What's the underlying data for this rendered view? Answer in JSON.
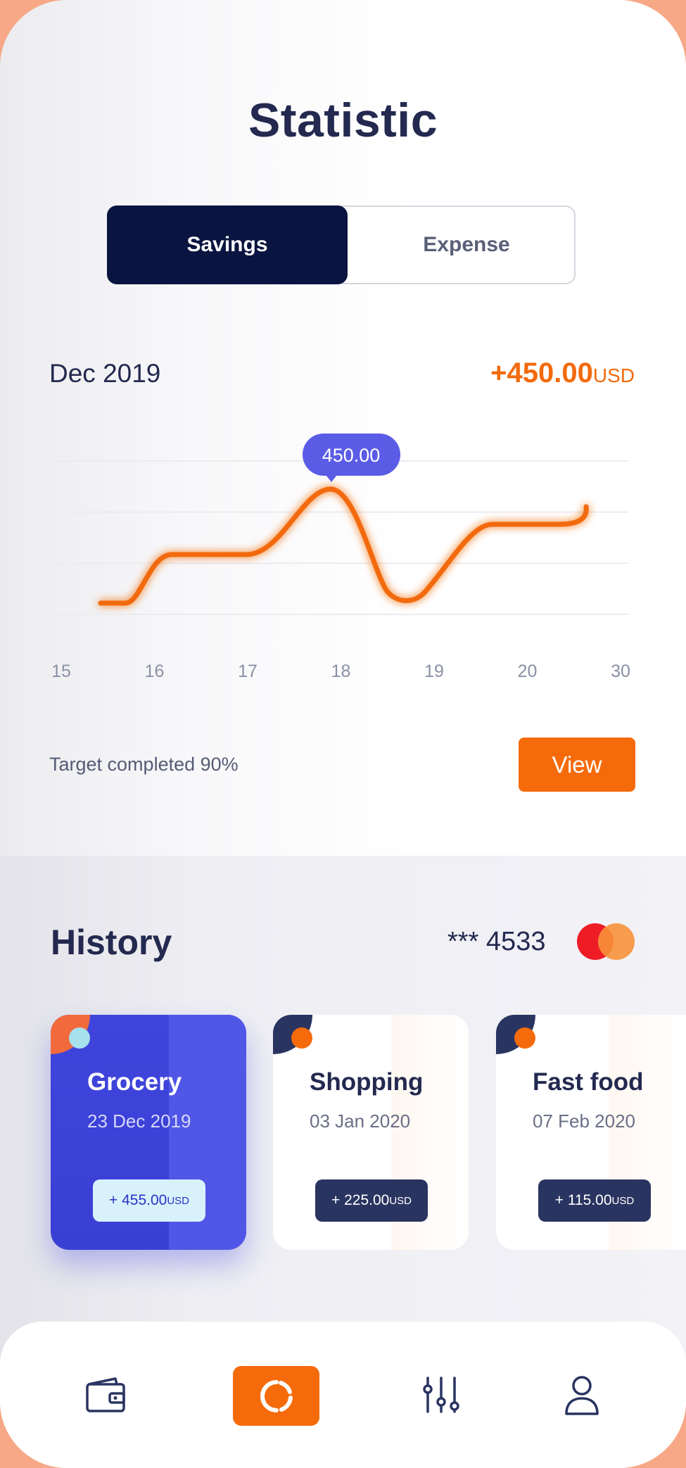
{
  "header": {
    "title": "Statistic"
  },
  "toggle": {
    "active": "Savings",
    "inactive": "Expense"
  },
  "summary": {
    "period": "Dec 2019",
    "amount": "+450.00",
    "currency": "USD"
  },
  "chart_data": {
    "type": "line",
    "x": [
      "15",
      "16",
      "17",
      "18",
      "19",
      "20",
      "30"
    ],
    "tooltip": "450.00",
    "color": "#f26a0d",
    "tooltip_color": "#5b5ce6",
    "grid": true,
    "gridlines": 4
  },
  "target": {
    "text": "Target completed 90%",
    "button": "View"
  },
  "history": {
    "title": "History",
    "card_number": "*** 4533",
    "items": [
      {
        "name": "Grocery",
        "date": "23 Dec 2019",
        "amount": "+ 455.00",
        "currency": "USD"
      },
      {
        "name": "Shopping",
        "date": "03 Jan 2020",
        "amount": "+ 225.00",
        "currency": "USD"
      },
      {
        "name": "Fast food",
        "date": "07 Feb 2020",
        "amount": "+ 115.00",
        "currency": "USD"
      }
    ]
  },
  "nav": {
    "items": [
      {
        "icon": "wallet-icon"
      },
      {
        "icon": "statistic-icon",
        "active": true
      },
      {
        "icon": "sliders-icon"
      },
      {
        "icon": "user-icon"
      }
    ]
  },
  "colors": {
    "accent": "#f56b0b",
    "navy": "#0a1440",
    "blue": "#3f45dc",
    "text": "#23294f"
  }
}
